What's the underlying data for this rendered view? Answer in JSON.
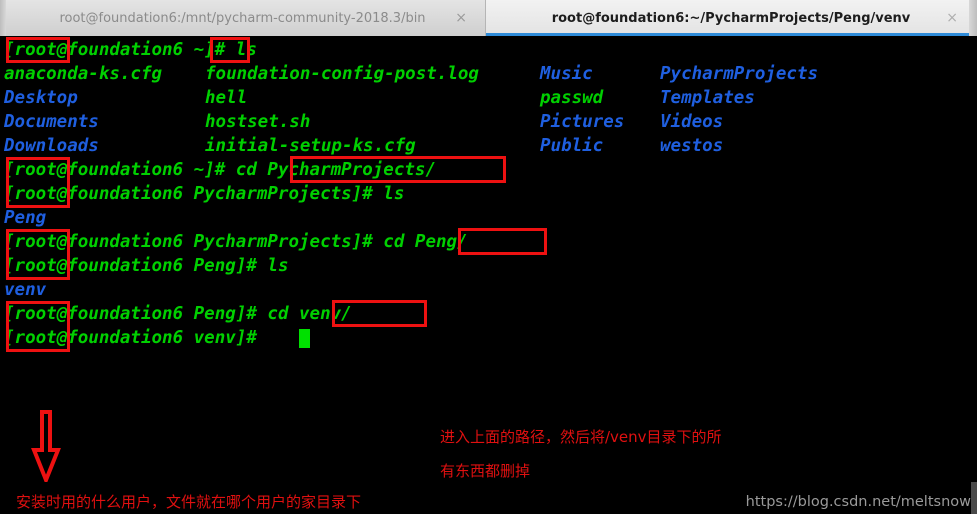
{
  "window": {
    "tabs": [
      {
        "title": "root@foundation6:/mnt/pycharm-community-2018.3/bin",
        "close": "×",
        "active": false
      },
      {
        "title": "root@foundation6:~/PycharmProjects/Peng/venv",
        "close": "×",
        "active": true
      }
    ]
  },
  "terminal": {
    "colors": {
      "background": "#000000",
      "green": "#00d000",
      "blue": "#1f5fe0",
      "annotation_red": "#ee1111"
    },
    "lines": [
      {
        "prompt": "[root@foundation6 ~]# ",
        "command": "ls"
      },
      {
        "prompt": "[root@foundation6 ~]# ",
        "command": "cd PycharmProjects/"
      },
      {
        "prompt": "[root@foundation6 PycharmProjects]# ",
        "command": "ls"
      },
      {
        "prompt": "[root@foundation6 PycharmProjects]# ",
        "command": "cd Peng/"
      },
      {
        "prompt": "[root@foundation6 Peng]# ",
        "command": "ls"
      },
      {
        "prompt": "[root@foundation6 Peng]# ",
        "command": "cd venv/"
      },
      {
        "prompt": "[root@foundation6 venv]# ",
        "command": ""
      }
    ],
    "ls_home": {
      "col1": [
        {
          "name": "anaconda-ks.cfg",
          "type": "file"
        },
        {
          "name": "Desktop",
          "type": "dir"
        },
        {
          "name": "Documents",
          "type": "dir"
        },
        {
          "name": "Downloads",
          "type": "dir"
        }
      ],
      "col2": [
        {
          "name": "foundation-config-post.log",
          "type": "file"
        },
        {
          "name": "hell",
          "type": "file"
        },
        {
          "name": "hostset.sh",
          "type": "file"
        },
        {
          "name": "initial-setup-ks.cfg",
          "type": "file"
        }
      ],
      "col3": [
        {
          "name": "Music",
          "type": "dir"
        },
        {
          "name": "passwd",
          "type": "file"
        },
        {
          "name": "Pictures",
          "type": "dir"
        },
        {
          "name": "Public",
          "type": "dir"
        }
      ],
      "col4": [
        {
          "name": "PycharmProjects",
          "type": "dir"
        },
        {
          "name": "Templates",
          "type": "dir"
        },
        {
          "name": "Videos",
          "type": "dir"
        },
        {
          "name": "westos",
          "type": "dir"
        }
      ]
    },
    "ls_pycharmprojects": [
      {
        "name": "Peng",
        "type": "dir"
      }
    ],
    "ls_peng": [
      {
        "name": "venv",
        "type": "dir"
      }
    ]
  },
  "annotations": {
    "note_right_line1": "进入上面的路径，然后将/venv目录下的所",
    "note_right_line2": "有东西都删掉",
    "note_bottom": "安装时用的什么用户，文件就在哪个用户的家目录下"
  },
  "watermark": {
    "text": "https://blog.csdn.net/meltsnow"
  }
}
